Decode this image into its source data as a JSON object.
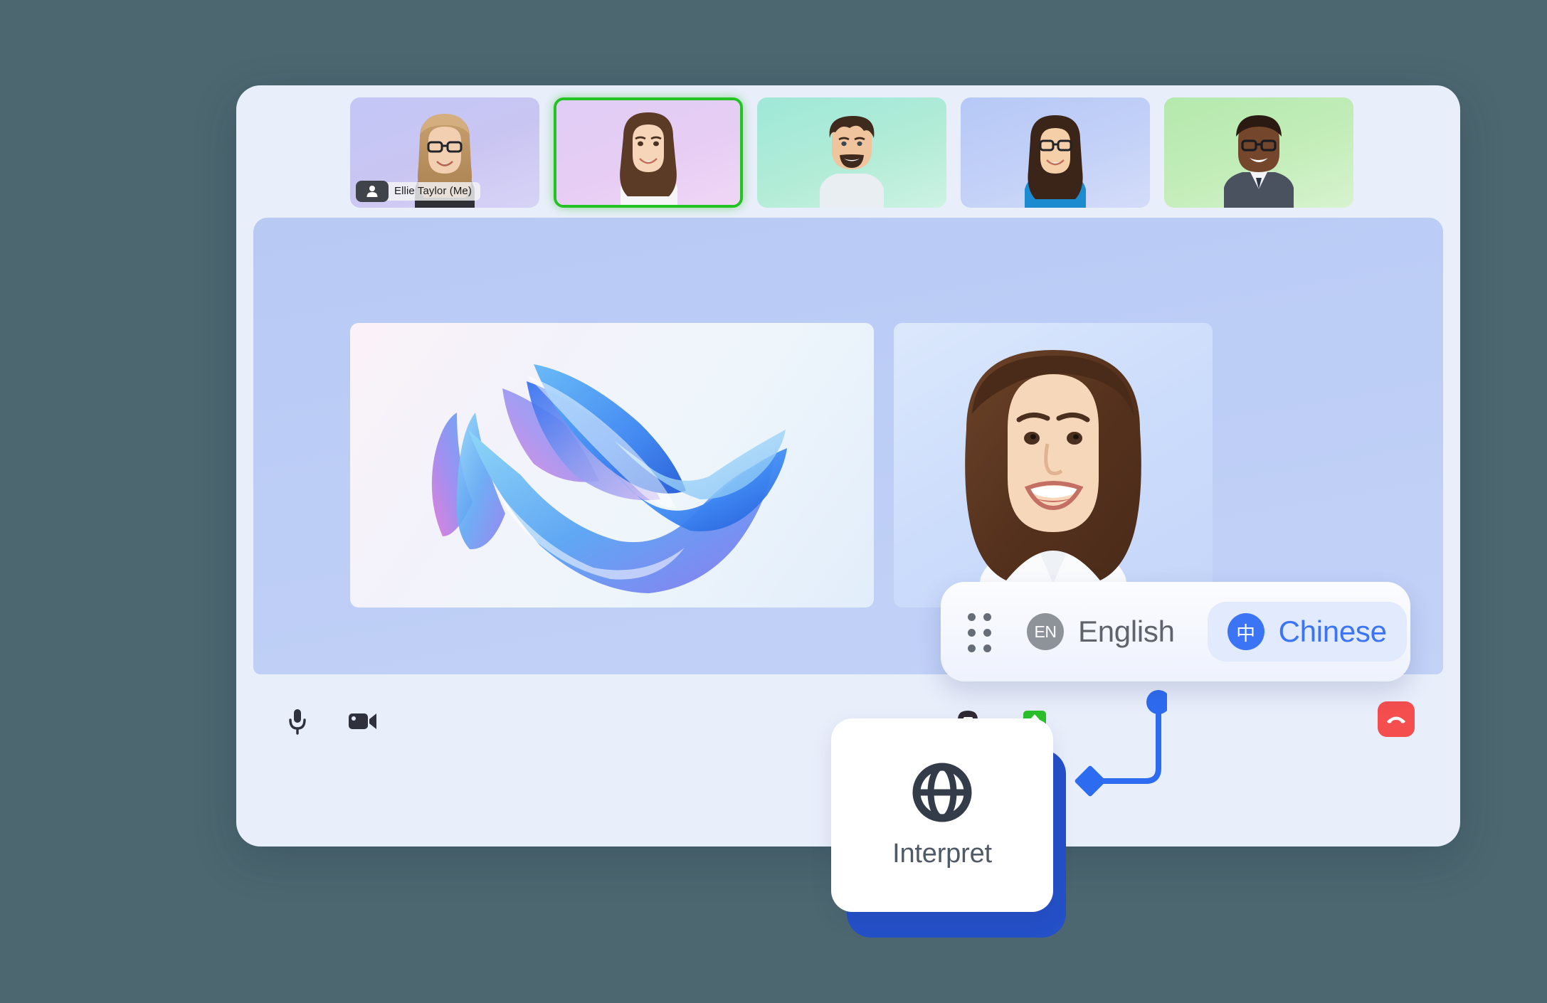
{
  "app": {
    "background_color": "#4c6770",
    "window_bg": "#e9eefb",
    "stage_bg": "#bccdf6",
    "accent_blue": "#3b74f5",
    "connector_blue": "#2d6bf0",
    "active_speaker_green": "#22c322",
    "share_green": "#2cc02c",
    "end_call_red": "#f44e4e"
  },
  "filmstrip": {
    "participants": [
      {
        "id": "participant-1",
        "name": "Ellie Taylor",
        "name_suffix": "(Me)",
        "badge_label": "Ellie Taylor  (Me)",
        "is_self": true,
        "active_speaker": false,
        "avatar_icon": "person-icon",
        "tile_class": "t1"
      },
      {
        "id": "participant-2",
        "name": "",
        "badge_label": "",
        "is_self": false,
        "active_speaker": true,
        "avatar_icon": "",
        "tile_class": "t2"
      },
      {
        "id": "participant-3",
        "name": "",
        "badge_label": "",
        "is_self": false,
        "active_speaker": false,
        "avatar_icon": "",
        "tile_class": "t3"
      },
      {
        "id": "participant-4",
        "name": "",
        "badge_label": "",
        "is_self": false,
        "active_speaker": false,
        "avatar_icon": "",
        "tile_class": "t4"
      },
      {
        "id": "participant-5",
        "name": "",
        "badge_label": "",
        "is_self": false,
        "active_speaker": false,
        "avatar_icon": "",
        "tile_class": "t5"
      }
    ]
  },
  "stage": {
    "shared_screen": {
      "name": "shared-screen-content",
      "description": "abstract blue purple ribbon artwork"
    },
    "active_speaker_video": {
      "name": "active-speaker-video",
      "description": "woman portrait on light blue background"
    }
  },
  "toolbar": {
    "mic": {
      "icon": "microphone-icon",
      "label": ""
    },
    "camera": {
      "icon": "video-camera-icon",
      "label": ""
    },
    "chat": {
      "icon": "chat-bubble-icon",
      "label": ""
    },
    "share_screen": {
      "icon": "share-screen-icon",
      "label": ""
    },
    "end_call": {
      "icon": "end-call-icon",
      "label": ""
    }
  },
  "language_pill": {
    "drag_handle_icon": "drag-handle-icon",
    "options": [
      {
        "code": "EN",
        "label": "English",
        "selected": false
      },
      {
        "code": "中",
        "label": "Chinese",
        "selected": true
      }
    ]
  },
  "interpret_card": {
    "icon": "globe-icon",
    "label": "Interpret"
  }
}
